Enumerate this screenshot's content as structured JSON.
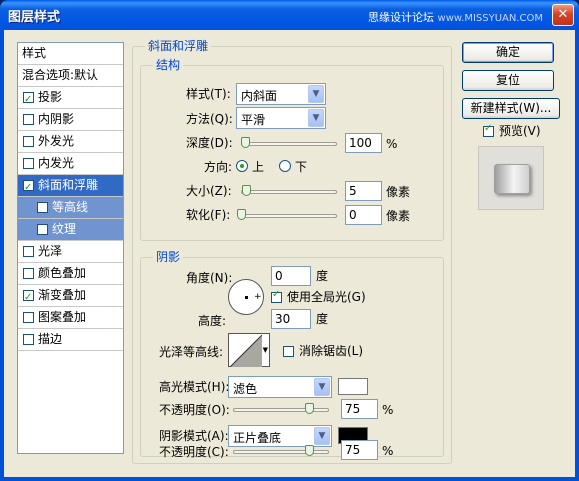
{
  "window": {
    "title": "图层样式",
    "watermark": "思缘设计论坛",
    "watermark_url": "www.MISSYUAN.COM",
    "close_label": "✕"
  },
  "styles_list": {
    "header": "样式",
    "blend_options": "混合选项:默认",
    "items": [
      {
        "label": "投影",
        "checked": true
      },
      {
        "label": "内阴影",
        "checked": false
      },
      {
        "label": "外发光",
        "checked": false
      },
      {
        "label": "内发光",
        "checked": false
      },
      {
        "label": "斜面和浮雕",
        "checked": true,
        "selected": true
      },
      {
        "label": "等高线",
        "checked": false,
        "sub": true
      },
      {
        "label": "纹理",
        "checked": false,
        "sub": true
      },
      {
        "label": "光泽",
        "checked": false
      },
      {
        "label": "颜色叠加",
        "checked": false
      },
      {
        "label": "渐变叠加",
        "checked": true
      },
      {
        "label": "图案叠加",
        "checked": false
      },
      {
        "label": "描边",
        "checked": false
      }
    ]
  },
  "bevel": {
    "group_title": "斜面和浮雕",
    "structure": {
      "title": "结构",
      "style_label": "样式(T):",
      "style_value": "内斜面",
      "technique_label": "方法(Q):",
      "technique_value": "平滑",
      "depth_label": "深度(D):",
      "depth_value": "100",
      "depth_unit": "%",
      "direction_label": "方向:",
      "direction_up": "上",
      "direction_down": "下",
      "size_label": "大小(Z):",
      "size_value": "5",
      "size_unit": "像素",
      "soften_label": "软化(F):",
      "soften_value": "0",
      "soften_unit": "像素"
    },
    "shading": {
      "title": "阴影",
      "angle_label": "角度(N):",
      "angle_value": "0",
      "angle_unit": "度",
      "global_light_label": "使用全局光(G)",
      "global_light_checked": true,
      "altitude_label": "高度:",
      "altitude_value": "30",
      "altitude_unit": "度",
      "gloss_contour_label": "光泽等高线:",
      "anti_alias_label": "消除锯齿(L)",
      "anti_alias_checked": false,
      "highlight_mode_label": "高光模式(H):",
      "highlight_mode_value": "滤色",
      "highlight_color": "#ffffff",
      "highlight_opacity_label": "不透明度(O):",
      "highlight_opacity_value": "75",
      "highlight_opacity_unit": "%",
      "shadow_mode_label": "阴影模式(A):",
      "shadow_mode_value": "正片叠底",
      "shadow_color": "#000000",
      "shadow_opacity_label": "不透明度(C):",
      "shadow_opacity_value": "75",
      "shadow_opacity_unit": "%"
    }
  },
  "buttons": {
    "ok": "确定",
    "reset": "复位",
    "new_style": "新建样式(W)...",
    "preview_label": "预览(V)",
    "preview_checked": true
  },
  "colors": {
    "accent": "#316ac5",
    "group_title": "#0046d5",
    "titlebar": "#0054e3"
  }
}
